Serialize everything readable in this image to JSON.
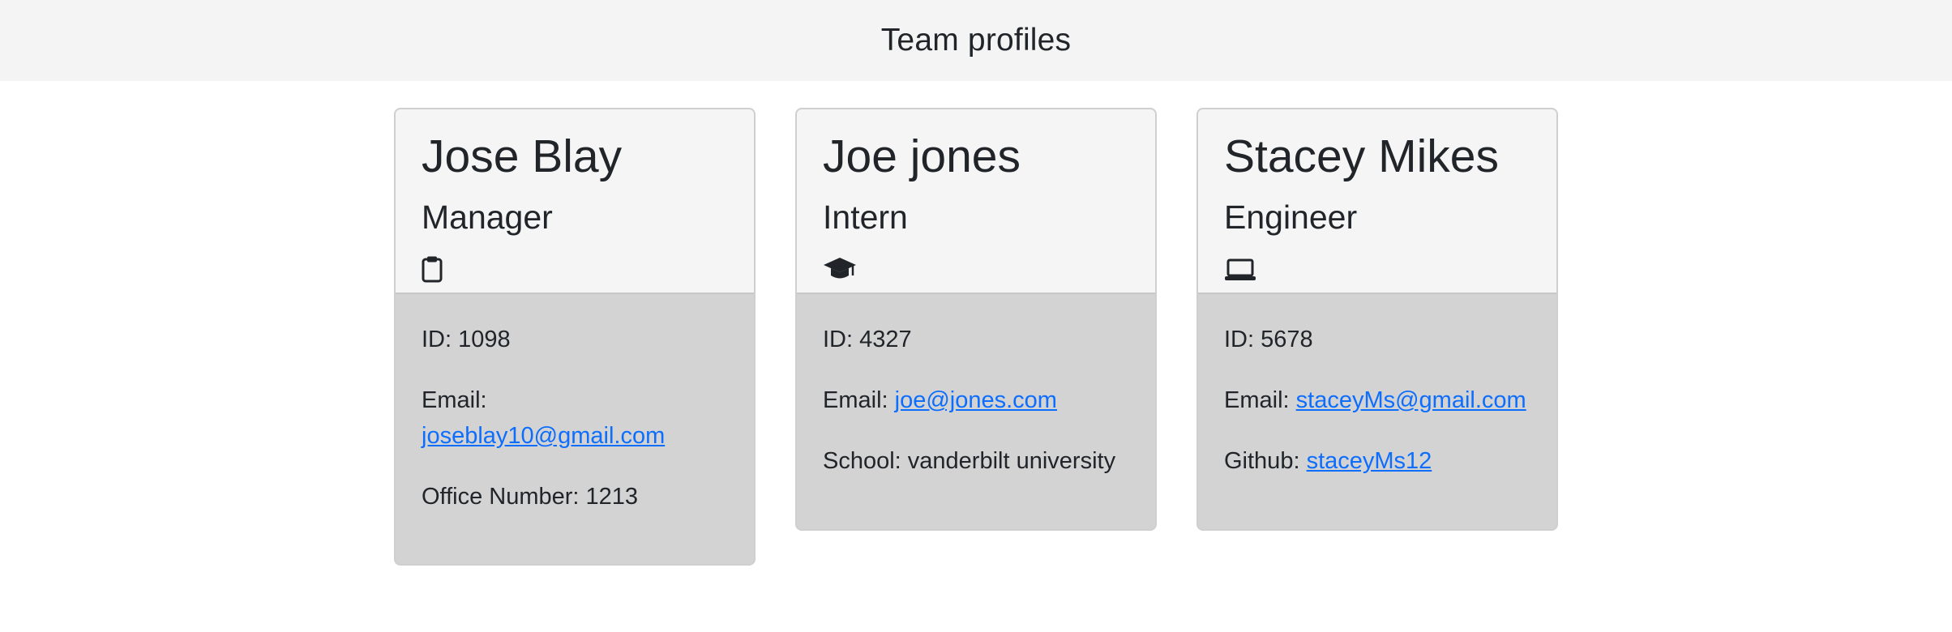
{
  "header": {
    "title": "Team profiles"
  },
  "employees": [
    {
      "name": "Jose Blay",
      "role": "Manager",
      "icon": "clipboard-icon",
      "id_label": "ID: 1098",
      "email_label": "Email:",
      "email": "joseblay10@gmail.com",
      "extra_label": "Office Number: 1213"
    },
    {
      "name": "Joe jones",
      "role": "Intern",
      "icon": "graduation-cap-icon",
      "id_label": "ID: 4327",
      "email_label": "Email:",
      "email": "joe@jones.com",
      "extra_label": "School: vanderbilt university"
    },
    {
      "name": "Stacey Mikes",
      "role": "Engineer",
      "icon": "laptop-icon",
      "id_label": "ID: 5678",
      "email_label": "Email:",
      "email": "staceyMs@gmail.com",
      "extra_label": "Github:",
      "github": "staceyMs12"
    }
  ],
  "colors": {
    "link": "#0d6efd",
    "card_header": "#f5f5f5",
    "card_body": "#d3d3d3",
    "page_header": "#f4f4f4"
  }
}
